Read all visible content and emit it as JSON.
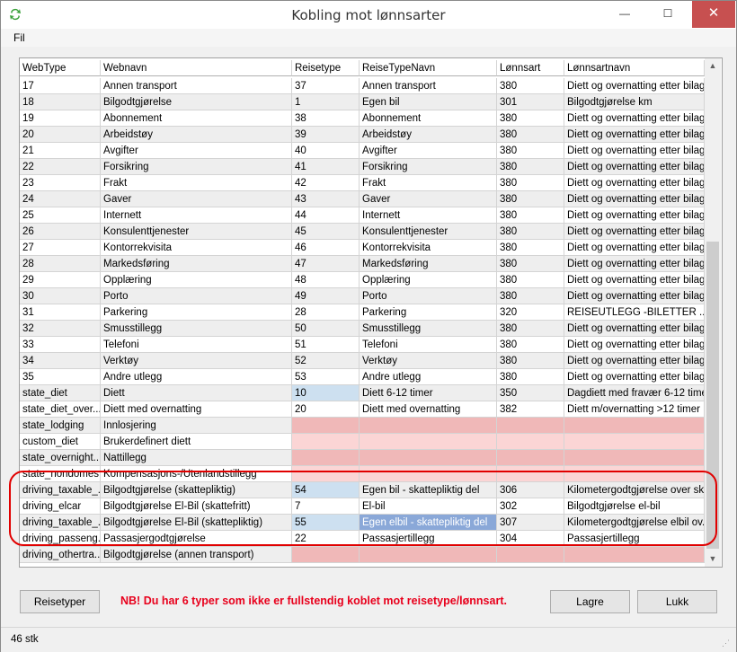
{
  "window": {
    "title": "Kobling mot lønnsarter",
    "minimize": "—",
    "maximize": "☐",
    "close": "✕"
  },
  "menu": {
    "file": "Fil"
  },
  "columns": [
    "WebType",
    "Webnavn",
    "Reisetype",
    "ReiseTypeNavn",
    "Lønnsart",
    "Lønnsartnavn"
  ],
  "rows": [
    {
      "cells": [
        "17",
        "Annen transport",
        "37",
        "Annen transport",
        "380",
        "Diett og overnatting etter bilag"
      ],
      "state": "ok"
    },
    {
      "cells": [
        "18",
        "Bilgodtgjørelse",
        "1",
        "Egen bil",
        "301",
        "Bilgodtgjørelse km"
      ],
      "state": "ok"
    },
    {
      "cells": [
        "19",
        "Abonnement",
        "38",
        "Abonnement",
        "380",
        "Diett og overnatting etter bilag"
      ],
      "state": "ok"
    },
    {
      "cells": [
        "20",
        "Arbeidstøy",
        "39",
        "Arbeidstøy",
        "380",
        "Diett og overnatting etter bilag"
      ],
      "state": "ok"
    },
    {
      "cells": [
        "21",
        "Avgifter",
        "40",
        "Avgifter",
        "380",
        "Diett og overnatting etter bilag"
      ],
      "state": "ok"
    },
    {
      "cells": [
        "22",
        "Forsikring",
        "41",
        "Forsikring",
        "380",
        "Diett og overnatting etter bilag"
      ],
      "state": "ok"
    },
    {
      "cells": [
        "23",
        "Frakt",
        "42",
        "Frakt",
        "380",
        "Diett og overnatting etter bilag"
      ],
      "state": "ok"
    },
    {
      "cells": [
        "24",
        "Gaver",
        "43",
        "Gaver",
        "380",
        "Diett og overnatting etter bilag"
      ],
      "state": "ok"
    },
    {
      "cells": [
        "25",
        "Internett",
        "44",
        "Internett",
        "380",
        "Diett og overnatting etter bilag"
      ],
      "state": "ok"
    },
    {
      "cells": [
        "26",
        "Konsulenttjenester",
        "45",
        "Konsulenttjenester",
        "380",
        "Diett og overnatting etter bilag"
      ],
      "state": "ok"
    },
    {
      "cells": [
        "27",
        "Kontorrekvisita",
        "46",
        "Kontorrekvisita",
        "380",
        "Diett og overnatting etter bilag"
      ],
      "state": "ok"
    },
    {
      "cells": [
        "28",
        "Markedsføring",
        "47",
        "Markedsføring",
        "380",
        "Diett og overnatting etter bilag"
      ],
      "state": "ok"
    },
    {
      "cells": [
        "29",
        "Opplæring",
        "48",
        "Opplæring",
        "380",
        "Diett og overnatting etter bilag"
      ],
      "state": "ok"
    },
    {
      "cells": [
        "30",
        "Porto",
        "49",
        "Porto",
        "380",
        "Diett og overnatting etter bilag"
      ],
      "state": "ok"
    },
    {
      "cells": [
        "31",
        "Parkering",
        "28",
        "Parkering",
        "320",
        "REISEUTLEGG -BILETTER ..."
      ],
      "state": "ok"
    },
    {
      "cells": [
        "32",
        "Smusstillegg",
        "50",
        "Smusstillegg",
        "380",
        "Diett og overnatting etter bilag"
      ],
      "state": "ok"
    },
    {
      "cells": [
        "33",
        "Telefoni",
        "51",
        "Telefoni",
        "380",
        "Diett og overnatting etter bilag"
      ],
      "state": "ok"
    },
    {
      "cells": [
        "34",
        "Verktøy",
        "52",
        "Verktøy",
        "380",
        "Diett og overnatting etter bilag"
      ],
      "state": "ok"
    },
    {
      "cells": [
        "35",
        "Andre utlegg",
        "53",
        "Andre utlegg",
        "380",
        "Diett og overnatting etter bilag"
      ],
      "state": "ok"
    },
    {
      "cells": [
        "state_diet",
        "Diett",
        "10",
        "Diett 6-12 timer",
        "350",
        "Dagdiett med fravær 6-12 timer"
      ],
      "state": "ok",
      "focus": 2
    },
    {
      "cells": [
        "state_diet_over...",
        "Diett med overnatting",
        "20",
        "Diett med overnatting",
        "382",
        "Diett m/overnatting  >12 timer"
      ],
      "state": "ok"
    },
    {
      "cells": [
        "state_lodging",
        "Innlosjering",
        "",
        "",
        "",
        ""
      ],
      "state": "missing"
    },
    {
      "cells": [
        "custom_diet",
        "Brukerdefinert diett",
        "",
        "",
        "",
        ""
      ],
      "state": "missing"
    },
    {
      "cells": [
        "state_overnight...",
        "Nattillegg",
        "",
        "",
        "",
        ""
      ],
      "state": "missing"
    },
    {
      "cells": [
        "state_nondomes...",
        "Kompensasjons-/Utenlandstillegg",
        "",
        "",
        "",
        ""
      ],
      "state": "missing"
    },
    {
      "cells": [
        "driving_taxable_...",
        "Bilgodtgjørelse (skattepliktig)",
        "54",
        "Egen bil - skattepliktig del",
        "306",
        "Kilometergodtgjørelse over sk..."
      ],
      "state": "ok",
      "focus": 2
    },
    {
      "cells": [
        "driving_elcar",
        "Bilgodtgjørelse El-Bil (skattefritt)",
        "7",
        "El-bil",
        "302",
        "Bilgodtgjørelse el-bil"
      ],
      "state": "ok"
    },
    {
      "cells": [
        "driving_taxable_...",
        "Bilgodtgjørelse El-Bil (skattepliktig)",
        "55",
        "Egen elbil - skattepliktig del",
        "307",
        "Kilometergodtgjørelse elbil ov..."
      ],
      "state": "ok",
      "focus": 2,
      "selected": 3
    },
    {
      "cells": [
        "driving_passeng...",
        "Passasjergodtgjørelse",
        "22",
        "Passasjertillegg",
        "304",
        "Passasjertillegg"
      ],
      "state": "ok"
    },
    {
      "cells": [
        "driving_othertra...",
        "Bilgodtgjørelse (annen transport)",
        "",
        "",
        "",
        ""
      ],
      "state": "missing"
    }
  ],
  "buttons": {
    "travel_types": "Reisetyper",
    "save": "Lagre",
    "close": "Lukk"
  },
  "warning": "NB! Du har 6 typer som ikke er fullstendig koblet mot reisetype/lønnsart.",
  "status": "46 stk",
  "scrollbar": {
    "up": "▲",
    "down": "▼"
  },
  "colors": {
    "missing_light": "#fbd5d5",
    "missing_dark": "#f0b8b8",
    "focus_cell": "#cde0f0",
    "selected_cell": "#8aa8d8",
    "warning": "#e8001c",
    "alt_row": "#eeeeee"
  }
}
